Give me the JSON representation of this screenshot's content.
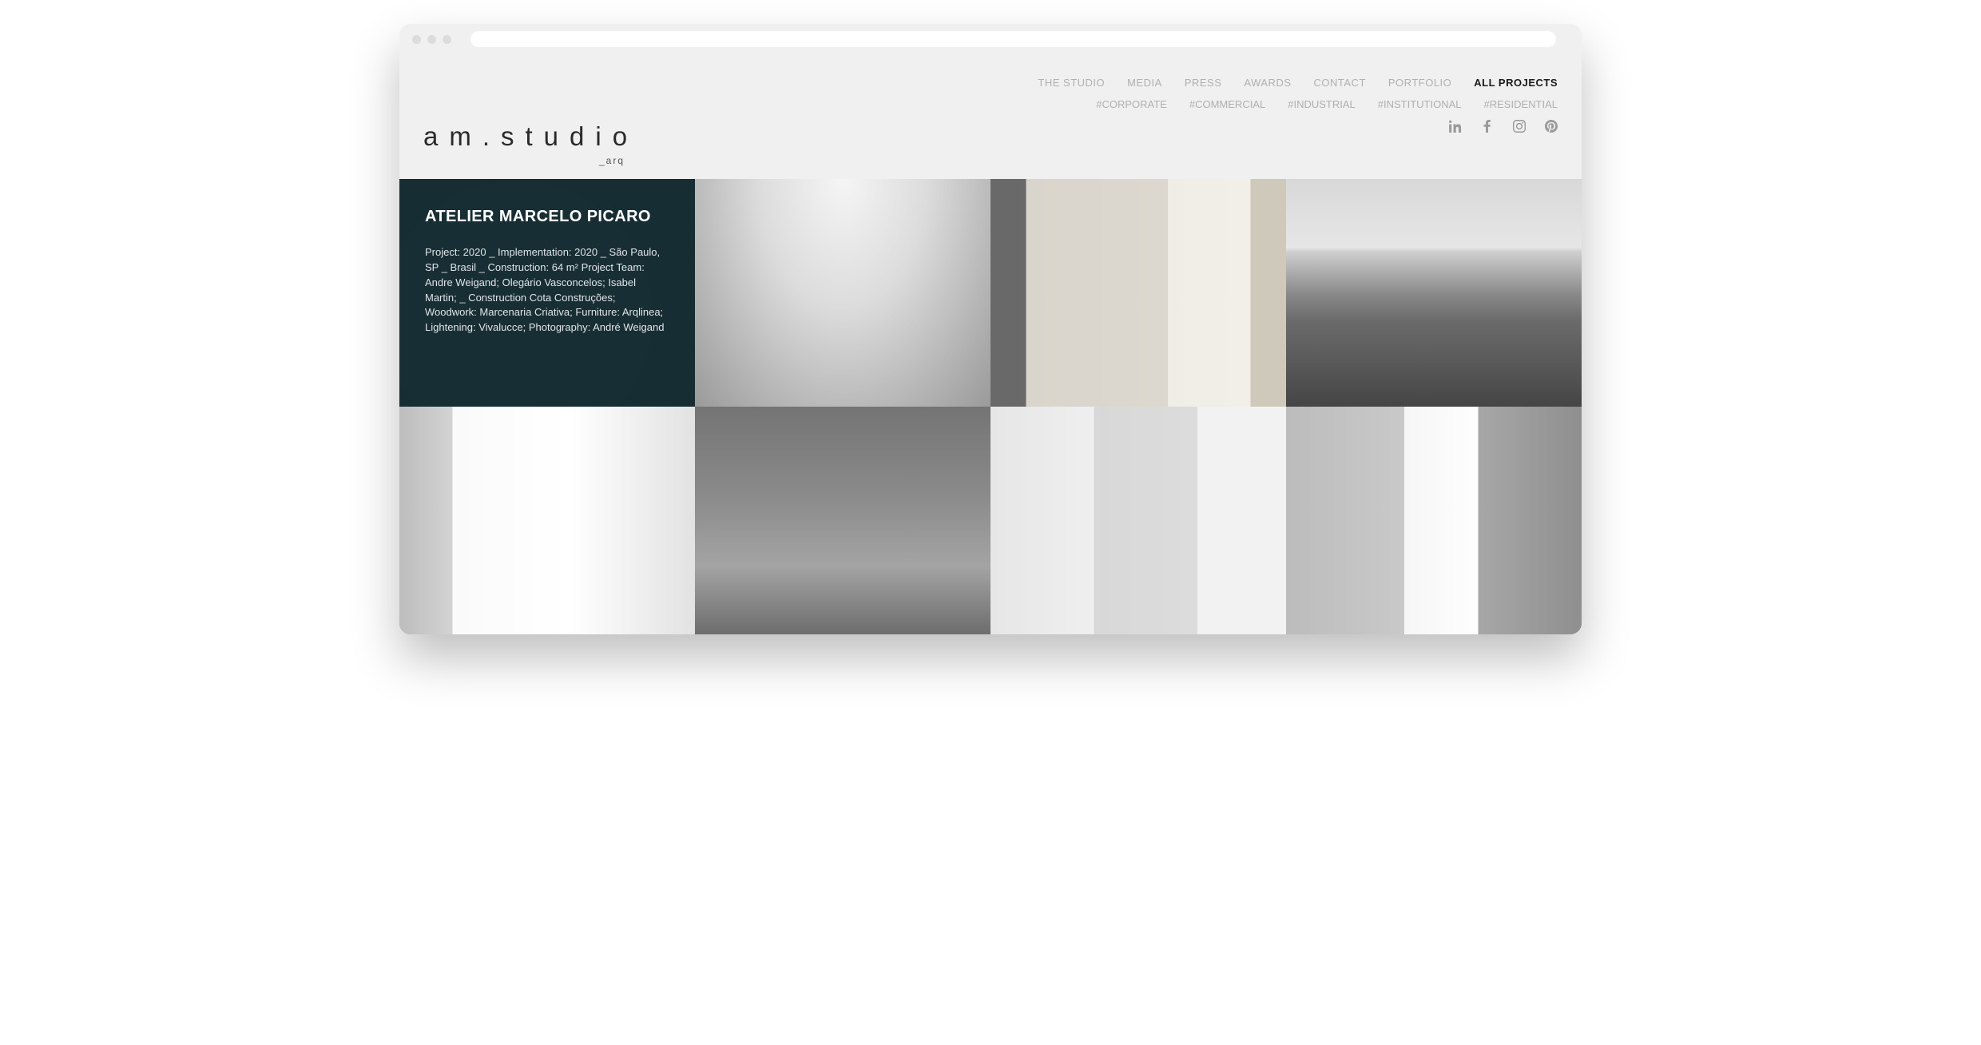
{
  "logo": {
    "main": "am.studio",
    "sub": "_arq"
  },
  "nav": {
    "items": [
      {
        "label": "THE STUDIO",
        "active": false
      },
      {
        "label": "MEDIA",
        "active": false
      },
      {
        "label": "PRESS",
        "active": false
      },
      {
        "label": "AWARDS",
        "active": false
      },
      {
        "label": "CONTACT",
        "active": false
      },
      {
        "label": "PORTFOLIO",
        "active": false
      },
      {
        "label": "ALL PROJECTS",
        "active": true
      }
    ]
  },
  "filters": {
    "items": [
      {
        "label": "#CORPORATE"
      },
      {
        "label": "#COMMERCIAL"
      },
      {
        "label": "#INDUSTRIAL"
      },
      {
        "label": "#INSTITUTIONAL"
      },
      {
        "label": "#RESIDENTIAL"
      }
    ]
  },
  "social": {
    "items": [
      {
        "name": "linkedin-icon"
      },
      {
        "name": "facebook-icon"
      },
      {
        "name": "instagram-icon"
      },
      {
        "name": "pinterest-icon"
      }
    ]
  },
  "featured": {
    "title": "ATELIER MARCELO PICARO",
    "description": "Project: 2020 _ Implementation: 2020 _ São Paulo, SP _ Brasil _ Construction: 64 m² Project Team: Andre Weigand; Olegário Vasconcelos; Isabel Martin; _ Construction Cota Construções; Woodwork: Marcenaria Criativa; Furniture: Arqlinea; Lightening: Vivalucce; Photography: André Weigand"
  },
  "tiles": [
    {
      "id": "atelier-marcelo-picaro",
      "overlay": true
    },
    {
      "id": "warehouse"
    },
    {
      "id": "kitchen-dining"
    },
    {
      "id": "landscape"
    },
    {
      "id": "interior-seating"
    },
    {
      "id": "loft-living"
    },
    {
      "id": "hallway"
    },
    {
      "id": "living-room"
    }
  ]
}
